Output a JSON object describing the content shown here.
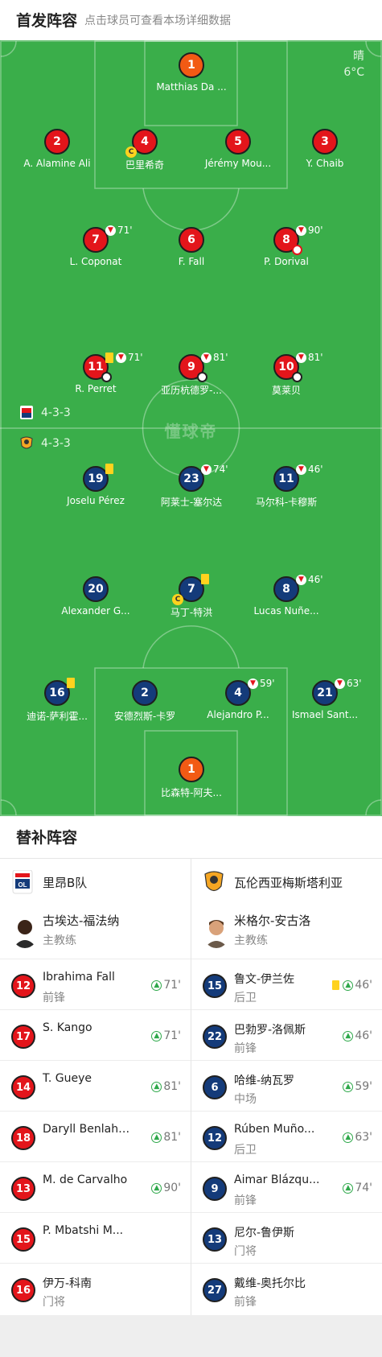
{
  "lineup": {
    "title": "首发阵容",
    "subtitle": "点击球员可查看本场详细数据"
  },
  "weather": {
    "condition": "晴",
    "temp": "6°C"
  },
  "watermark": "懂球帝",
  "formations": {
    "home": "4-3-3",
    "away": "4-3-3"
  },
  "colors": {
    "pitch": "#3aae4a",
    "home": "#e3151b",
    "away": "#143b7a",
    "goalkeeper": "#f25a14",
    "yellow": "#ffd21e",
    "sub_in": "#2ea84a"
  },
  "home_players": [
    {
      "number": "1",
      "name": "Matthias Da ...",
      "role": "gk"
    },
    {
      "number": "2",
      "name": "A. Alamine Ali"
    },
    {
      "number": "4",
      "name": "巴里希奇",
      "captain": "C"
    },
    {
      "number": "5",
      "name": "Jérémy Mou..."
    },
    {
      "number": "3",
      "name": "Y. Chaib"
    },
    {
      "number": "7",
      "name": "L. Coponat",
      "sub_out": "71'"
    },
    {
      "number": "6",
      "name": "F. Fall"
    },
    {
      "number": "8",
      "name": "P. Dorival",
      "sub_out": "90'",
      "own_goal": true
    },
    {
      "number": "11",
      "name": "R. Perret",
      "yellow": true,
      "sub_out": "71'",
      "goal": true
    },
    {
      "number": "9",
      "name": "亚历杭德罗-...",
      "sub_out": "81'",
      "goal": true
    },
    {
      "number": "10",
      "name": "莫莱贝",
      "sub_out": "81'",
      "goal": true
    }
  ],
  "away_players": [
    {
      "number": "19",
      "name": "Joselu Pérez",
      "yellow": true
    },
    {
      "number": "23",
      "name": "阿莱士-塞尔达",
      "sub_out": "74'"
    },
    {
      "number": "11",
      "name": "马尔科-卡穆斯",
      "sub_out": "46'"
    },
    {
      "number": "20",
      "name": "Alexander G..."
    },
    {
      "number": "7",
      "name": "马丁-特洪",
      "yellow": true,
      "captain": "C"
    },
    {
      "number": "8",
      "name": "Lucas Nuñe...",
      "sub_out": "46'"
    },
    {
      "number": "16",
      "name": "迪诺-萨利霍...",
      "yellow": true
    },
    {
      "number": "2",
      "name": "安德烈斯-卡罗"
    },
    {
      "number": "4",
      "name": "Alejandro P...",
      "sub_out": "59'"
    },
    {
      "number": "21",
      "name": "Ismael Sant...",
      "sub_out": "63'"
    },
    {
      "number": "1",
      "name": "比森特-阿夫...",
      "role": "gk"
    }
  ],
  "bench": {
    "title": "替补阵容",
    "home": {
      "team": "里昂B队",
      "coach": {
        "name": "古埃达-福法纳",
        "role": "主教练"
      },
      "subs": [
        {
          "number": "12",
          "name": "Ibrahima Fall",
          "position": "前锋",
          "in": "71'"
        },
        {
          "number": "17",
          "name": "S. Kango",
          "position": "",
          "in": "71'"
        },
        {
          "number": "14",
          "name": "T. Gueye",
          "position": "",
          "in": "81'"
        },
        {
          "number": "18",
          "name": "Daryll Benlahlou",
          "position": "",
          "in": "81'"
        },
        {
          "number": "13",
          "name": "M. de Carvalho",
          "position": "",
          "in": "90'"
        },
        {
          "number": "15",
          "name": "P. Mbatshi M...",
          "position": ""
        },
        {
          "number": "16",
          "name": "伊万-科南",
          "position": "门将"
        }
      ]
    },
    "away": {
      "team": "瓦伦西亚梅斯塔利亚",
      "coach": {
        "name": "米格尔-安古洛",
        "role": "主教练"
      },
      "subs": [
        {
          "number": "15",
          "name": "鲁文-伊兰佐",
          "position": "后卫",
          "yellow": true,
          "in": "46'"
        },
        {
          "number": "22",
          "name": "巴勃罗-洛佩斯",
          "position": "前锋",
          "in": "46'"
        },
        {
          "number": "6",
          "name": "哈维-纳瓦罗",
          "position": "中场",
          "in": "59'"
        },
        {
          "number": "12",
          "name": "Rúben Muño...",
          "position": "后卫",
          "in": "63'"
        },
        {
          "number": "9",
          "name": "Aimar Blázqu...",
          "position": "前锋",
          "in": "74'"
        },
        {
          "number": "13",
          "name": "尼尔-鲁伊斯",
          "position": "门将"
        },
        {
          "number": "27",
          "name": "戴维-奥托尔比",
          "position": "前锋"
        }
      ]
    }
  }
}
